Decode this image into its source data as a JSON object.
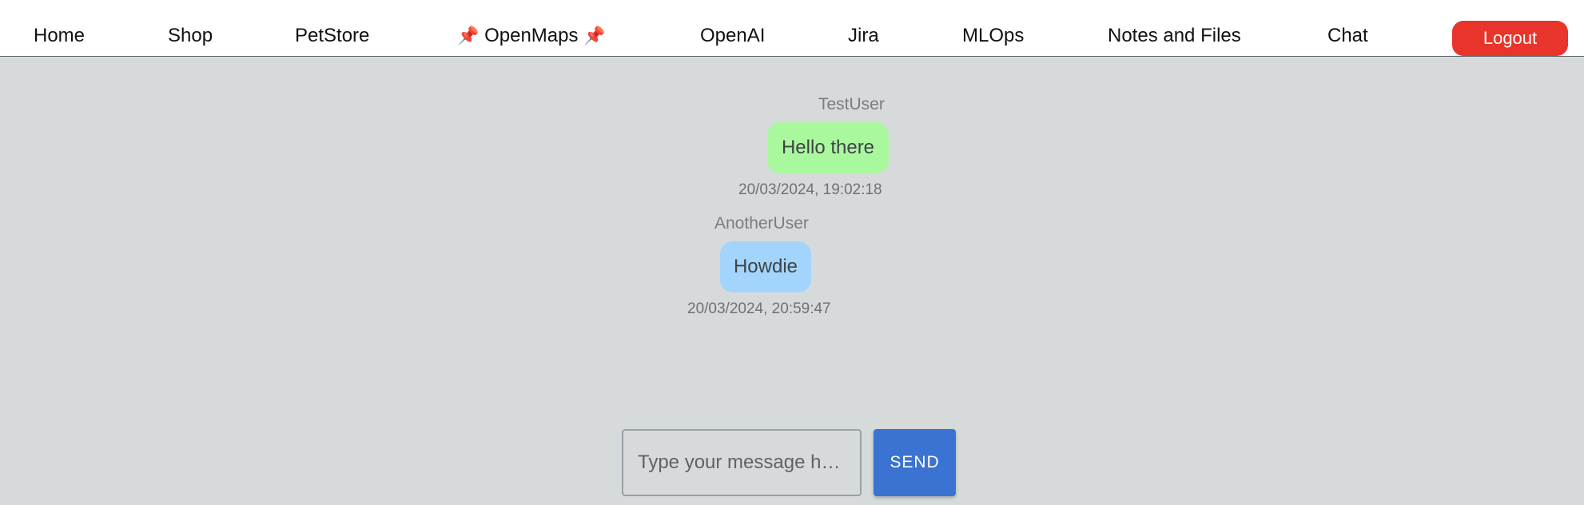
{
  "nav": {
    "items": [
      {
        "label": "Home"
      },
      {
        "label": "Shop"
      },
      {
        "label": "PetStore"
      },
      {
        "label": "OpenMaps",
        "pin_icon": "pushpin-icon"
      },
      {
        "label": "OpenAI"
      },
      {
        "label": "Jira"
      },
      {
        "label": "MLOps"
      },
      {
        "label": "Notes and Files"
      },
      {
        "label": "Chat"
      }
    ],
    "pin_glyph": "📌",
    "logout_label": "Logout"
  },
  "messages": [
    {
      "user": "TestUser",
      "text": "Hello there",
      "timestamp": "20/03/2024, 19:02:18",
      "color": "#a9f89e"
    },
    {
      "user": "AnotherUser",
      "text": "Howdie",
      "timestamp": "20/03/2024, 20:59:47",
      "color": "#a3d4fc"
    }
  ],
  "composer": {
    "placeholder": "Type your message h…",
    "value": "",
    "send_label": "SEND"
  },
  "colors": {
    "background": "#d7dadb",
    "logout": "#e8342a",
    "send": "#3a73d1"
  }
}
